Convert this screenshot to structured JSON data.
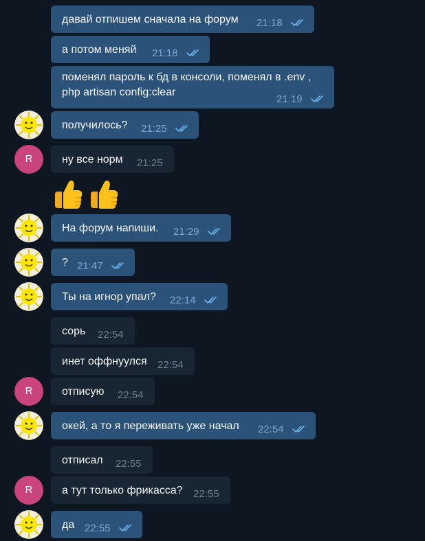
{
  "messages": [
    {
      "text": "давай отпишем сначала на форум",
      "time": "21:18"
    },
    {
      "text": "а потом меняй",
      "time": "21:18"
    },
    {
      "text_line1": "поменял пароль к бд в консоли, поменял в .env ,",
      "text_line2": "php artisan config:clear",
      "time": "21:19"
    },
    {
      "text": "получилось?",
      "time": "21:25"
    },
    {
      "text": "ну все норм",
      "time": "21:25"
    },
    {
      "text": "На форум напиши.",
      "time": "21:29"
    },
    {
      "text": "?",
      "time": "21:47"
    },
    {
      "text": "Ты на игнор упал?",
      "time": "22:14"
    },
    {
      "text": "сорь",
      "time": "22:54"
    },
    {
      "text": "инет оффнуулся",
      "time": "22:54"
    },
    {
      "text": "отписую",
      "time": "22:54"
    },
    {
      "text": "окей, а то я переживать уже начал",
      "time": "22:54"
    },
    {
      "text": "отписал",
      "time": "22:55"
    },
    {
      "text": "а тут только фрикасса?",
      "time": "22:55"
    },
    {
      "text": "да",
      "time": "22:55"
    }
  ],
  "avatar_letter": "R",
  "emoji": [
    "thumbs-up",
    "thumbs-up"
  ],
  "colors": {
    "background": "#0e1621",
    "outgoing_bubble": "#2b5278",
    "incoming_bubble": "#182533",
    "avatar_r": "#c9437c",
    "read_check": "#6cb4f0"
  }
}
